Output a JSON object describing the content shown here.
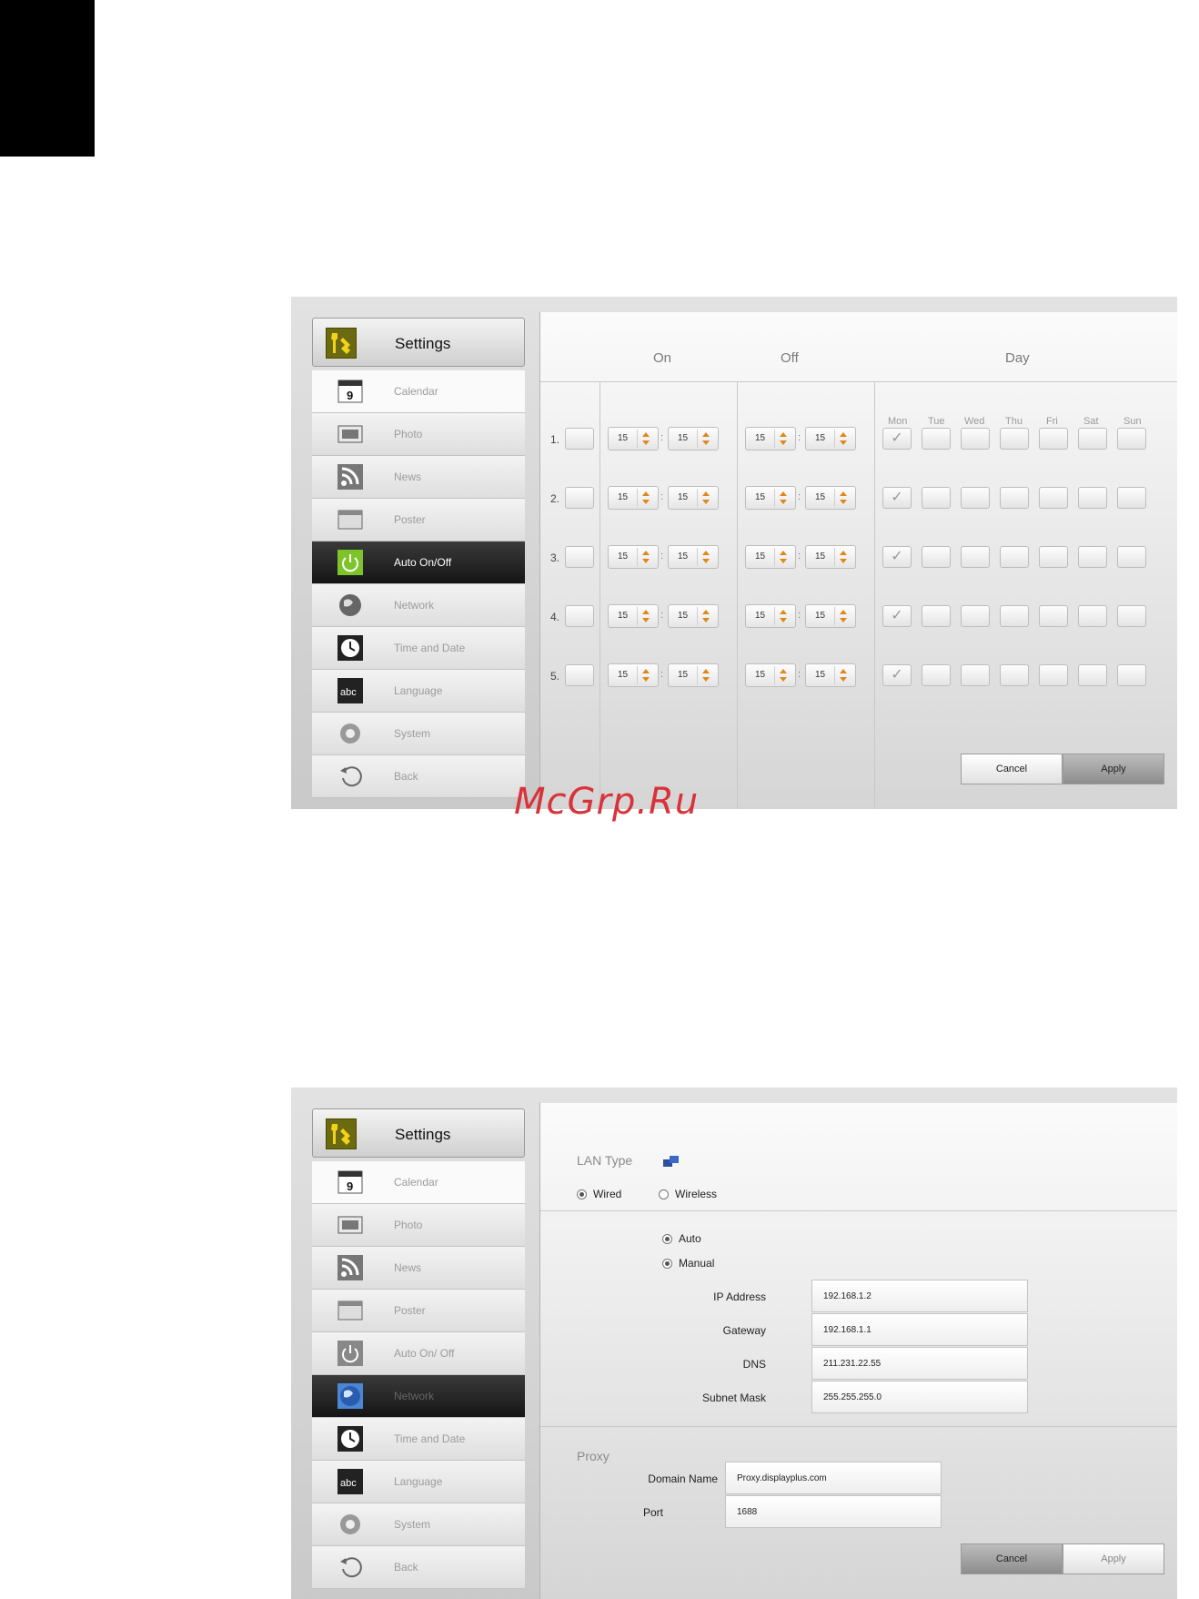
{
  "watermark": "McGrp.Ru",
  "sidebar": {
    "title": "Settings",
    "items": [
      {
        "label": "Calendar",
        "icon": "calendar-icon",
        "num": "9"
      },
      {
        "label": "Photo",
        "icon": "photo-icon"
      },
      {
        "label": "News",
        "icon": "rss-icon"
      },
      {
        "label": "Poster",
        "icon": "poster-icon"
      },
      {
        "label": "Auto On/Off",
        "icon": "power-icon"
      },
      {
        "label": "Network",
        "icon": "globe-icon"
      },
      {
        "label": "Time and Date",
        "icon": "clock-icon"
      },
      {
        "label": "Language",
        "icon": "abc-icon",
        "text": "abc"
      },
      {
        "label": "System",
        "icon": "gear-icon"
      },
      {
        "label": "Back",
        "icon": "back-arrow-icon"
      }
    ],
    "network_auto_label": "Auto On/ Off"
  },
  "schedule": {
    "headers": {
      "on": "On",
      "off": "Off",
      "day": "Day"
    },
    "days": [
      "Mon",
      "Tue",
      "Wed",
      "Thu",
      "Fri",
      "Sat",
      "Sun"
    ],
    "rows": [
      {
        "num": "1.",
        "on_h": "15",
        "on_m": "15",
        "off_h": "15",
        "off_m": "15",
        "mon": true
      },
      {
        "num": "2.",
        "on_h": "15",
        "on_m": "15",
        "off_h": "15",
        "off_m": "15",
        "mon": true
      },
      {
        "num": "3.",
        "on_h": "15",
        "on_m": "15",
        "off_h": "15",
        "off_m": "15",
        "mon": true
      },
      {
        "num": "4.",
        "on_h": "15",
        "on_m": "15",
        "off_h": "15",
        "off_m": "15",
        "mon": true
      },
      {
        "num": "5.",
        "on_h": "15",
        "on_m": "15",
        "off_h": "15",
        "off_m": "15",
        "mon": true
      }
    ],
    "colon": ":",
    "check": "✓",
    "cancel": "Cancel",
    "apply": "Apply"
  },
  "network": {
    "lan_type": "LAN Type",
    "wired": "Wired",
    "wireless": "Wireless",
    "auto": "Auto",
    "manual": "Manual",
    "ip_label": "IP Address",
    "ip": "192.168.1.2",
    "gateway_label": "Gateway",
    "gateway": "192.168.1.1",
    "dns_label": "DNS",
    "dns": "211.231.22.55",
    "subnet_label": "Subnet Mask",
    "subnet": "255.255.255.0",
    "proxy": "Proxy",
    "domain_label": "Domain Name",
    "domain": "Proxy.displayplus.com",
    "port_label": "Port",
    "port": "1688",
    "cancel": "Cancel",
    "apply": "Apply"
  }
}
